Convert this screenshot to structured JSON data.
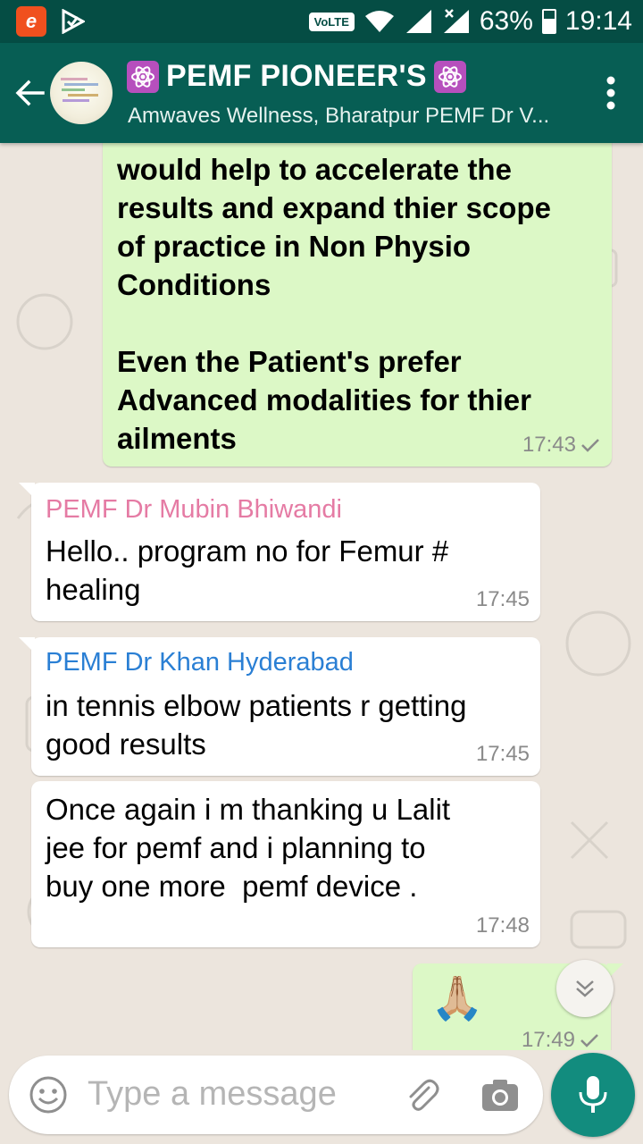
{
  "status_bar": {
    "network_label": "VoLTE",
    "battery": "63%",
    "time": "19:14"
  },
  "header": {
    "title": "PEMF PIONEER'S",
    "subtitle": "Amwaves Wellness, Bharatpur PEMF Dr V..."
  },
  "messages": [
    {
      "type": "outgoing",
      "lines": [
        "would help to accelerate the",
        "results and expand thier scope",
        "of practice in Non Physio",
        "Conditions",
        "",
        "Even the Patient's prefer",
        "Advanced modalities for thier",
        "ailments"
      ],
      "time": "17:43"
    },
    {
      "type": "incoming",
      "sender": "PEMF Dr Mubin Bhiwandi",
      "sender_color": "#e57ba4",
      "lines": [
        "Hello.. program no for Femur #",
        "healing"
      ],
      "time": "17:45"
    },
    {
      "type": "incoming",
      "sender": "PEMF Dr Khan Hyderabad",
      "sender_color": "#2a7fd4",
      "lines": [
        "in tennis elbow patients r getting",
        "good results"
      ],
      "time": "17:45"
    },
    {
      "type": "incoming",
      "lines": [
        "Once again i m thanking u Lalit",
        "jee for pemf and i planning to",
        "buy one more  pemf device ."
      ],
      "time": "17:48"
    },
    {
      "type": "outgoing",
      "emoji": "🙏🏼",
      "time": "17:49"
    }
  ],
  "input": {
    "placeholder": "Type a message"
  },
  "colors": {
    "header": "#075e54",
    "status_bar": "#054d44",
    "outgoing_bubble": "#dcf8c6",
    "fab": "#128c7e"
  },
  "icons": [
    "back-arrow-icon",
    "menu-dots-icon",
    "emoji-icon",
    "attach-icon",
    "camera-icon",
    "mic-icon",
    "scroll-down-icon",
    "atom-icon"
  ]
}
